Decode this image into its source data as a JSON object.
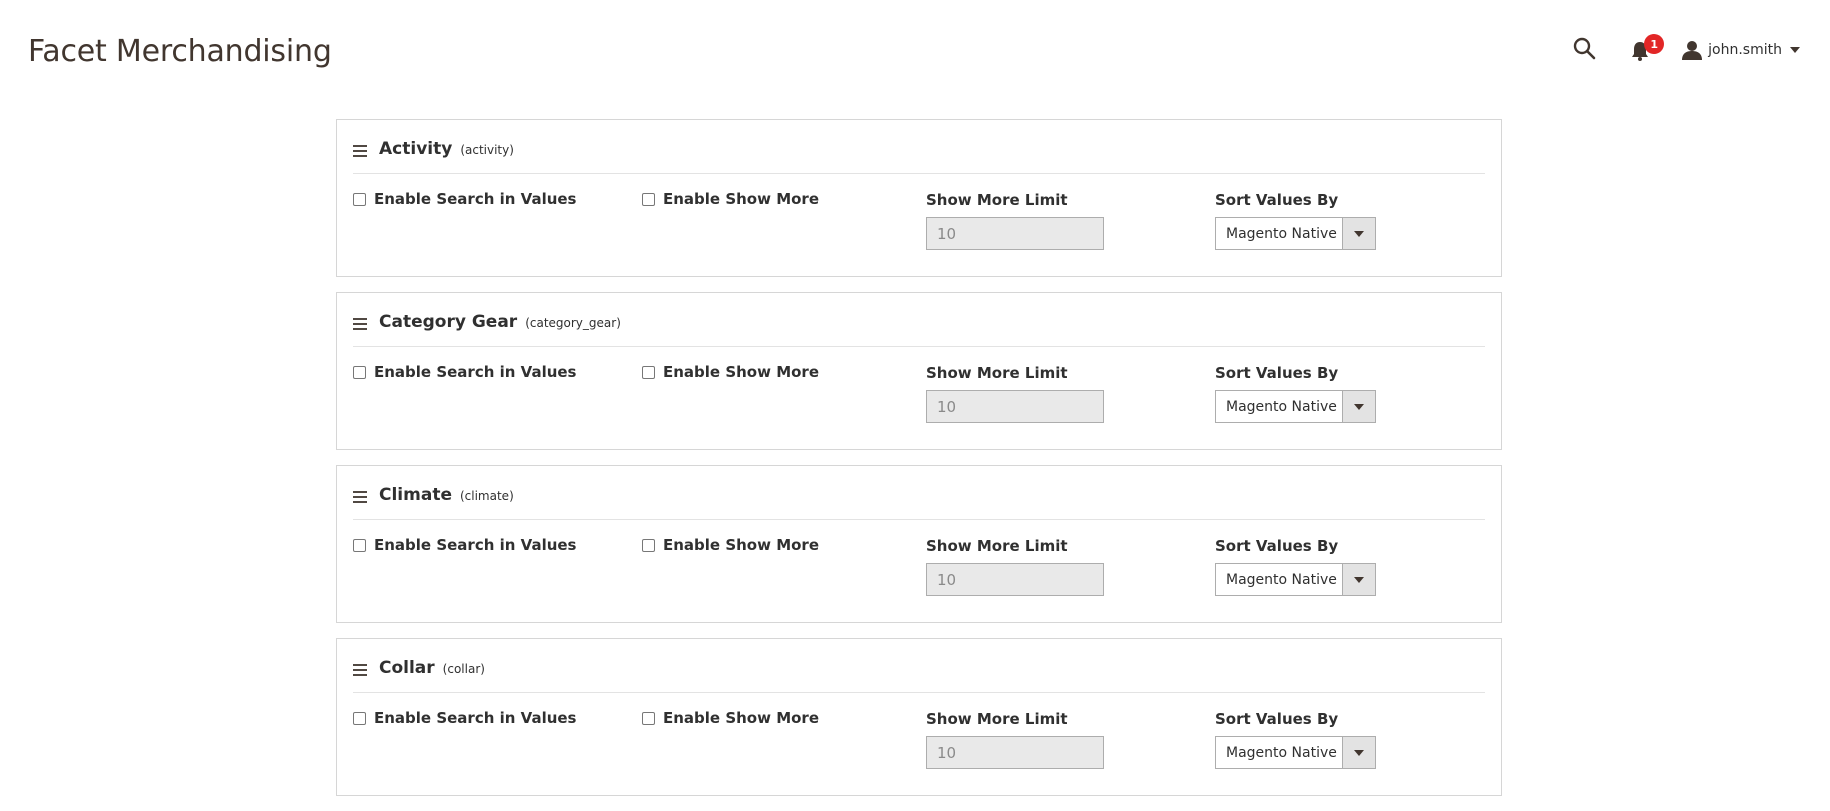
{
  "header": {
    "title": "Facet Merchandising",
    "notifications_count": "1",
    "user_name": "john.smith"
  },
  "facets": [
    {
      "name": "Activity",
      "code": "(activity)",
      "enable_search_label": "Enable Search in Values",
      "enable_show_more_label": "Enable Show More",
      "show_more_limit_label": "Show More Limit",
      "show_more_limit_value": "10",
      "sort_label": "Sort Values By",
      "sort_value": "Magento Native"
    },
    {
      "name": "Category Gear",
      "code": "(category_gear)",
      "enable_search_label": "Enable Search in Values",
      "enable_show_more_label": "Enable Show More",
      "show_more_limit_label": "Show More Limit",
      "show_more_limit_value": "10",
      "sort_label": "Sort Values By",
      "sort_value": "Magento Native"
    },
    {
      "name": "Climate",
      "code": "(climate)",
      "enable_search_label": "Enable Search in Values",
      "enable_show_more_label": "Enable Show More",
      "show_more_limit_label": "Show More Limit",
      "show_more_limit_value": "10",
      "sort_label": "Sort Values By",
      "sort_value": "Magento Native"
    },
    {
      "name": "Collar",
      "code": "(collar)",
      "enable_search_label": "Enable Search in Values",
      "enable_show_more_label": "Enable Show More",
      "show_more_limit_label": "Show More Limit",
      "show_more_limit_value": "10",
      "sort_label": "Sort Values By",
      "sort_value": "Magento Native"
    }
  ],
  "colors": {
    "badge": "#e22626",
    "border": "#d6d6d6",
    "disabled_input_bg": "#e9e9e9"
  },
  "icons": [
    "search-icon",
    "bell-icon",
    "user-icon",
    "chevron-down-icon",
    "drag-handle-icon",
    "dropdown-arrow-icon"
  ]
}
